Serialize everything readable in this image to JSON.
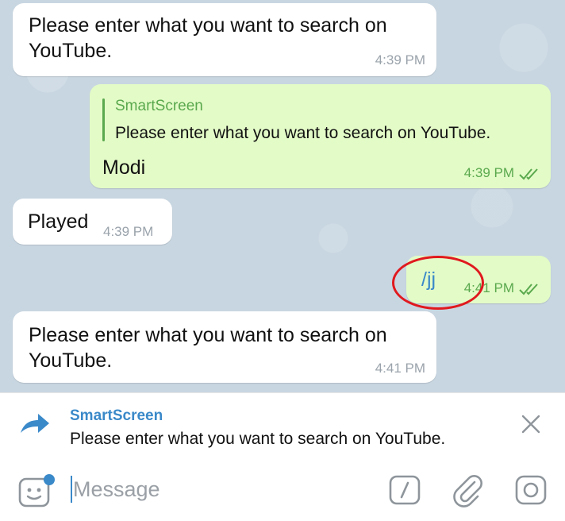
{
  "messages": [
    {
      "id": "m1",
      "direction": "in",
      "text_line1": "Please enter what you want to search on",
      "text_line2": "YouTube.",
      "time": "4:39 PM"
    },
    {
      "id": "m2",
      "direction": "out",
      "reply": {
        "name": "SmartScreen",
        "text": "Please enter what you want to search on YouTube."
      },
      "text": "Modi",
      "time": "4:39 PM",
      "read": true
    },
    {
      "id": "m3",
      "direction": "in",
      "text": "Played",
      "time": "4:39 PM"
    },
    {
      "id": "m4",
      "direction": "out",
      "text": "/jj",
      "time": "4:41 PM",
      "read": true,
      "highlighted": true
    },
    {
      "id": "m5",
      "direction": "in",
      "text_line1": "Please enter what you want to search on",
      "text_line2": "YouTube.",
      "time": "4:41 PM"
    }
  ],
  "forward_preview": {
    "title": "SmartScreen",
    "text": "Please enter what you want to search on YouTube."
  },
  "composer": {
    "placeholder": "Message"
  },
  "icons": {
    "forward": "forward-arrow-icon",
    "close": "close-icon",
    "sticker": "sticker-icon",
    "command": "slash-command-icon",
    "attach": "paperclip-icon",
    "camera": "camera-icon"
  },
  "colors": {
    "accent": "#3a89c9",
    "outgoing_bubble": "#e3fbc7",
    "outgoing_meta": "#5aa94e",
    "highlight_circle": "#e0191e",
    "chat_background": "#c8d6e1"
  }
}
